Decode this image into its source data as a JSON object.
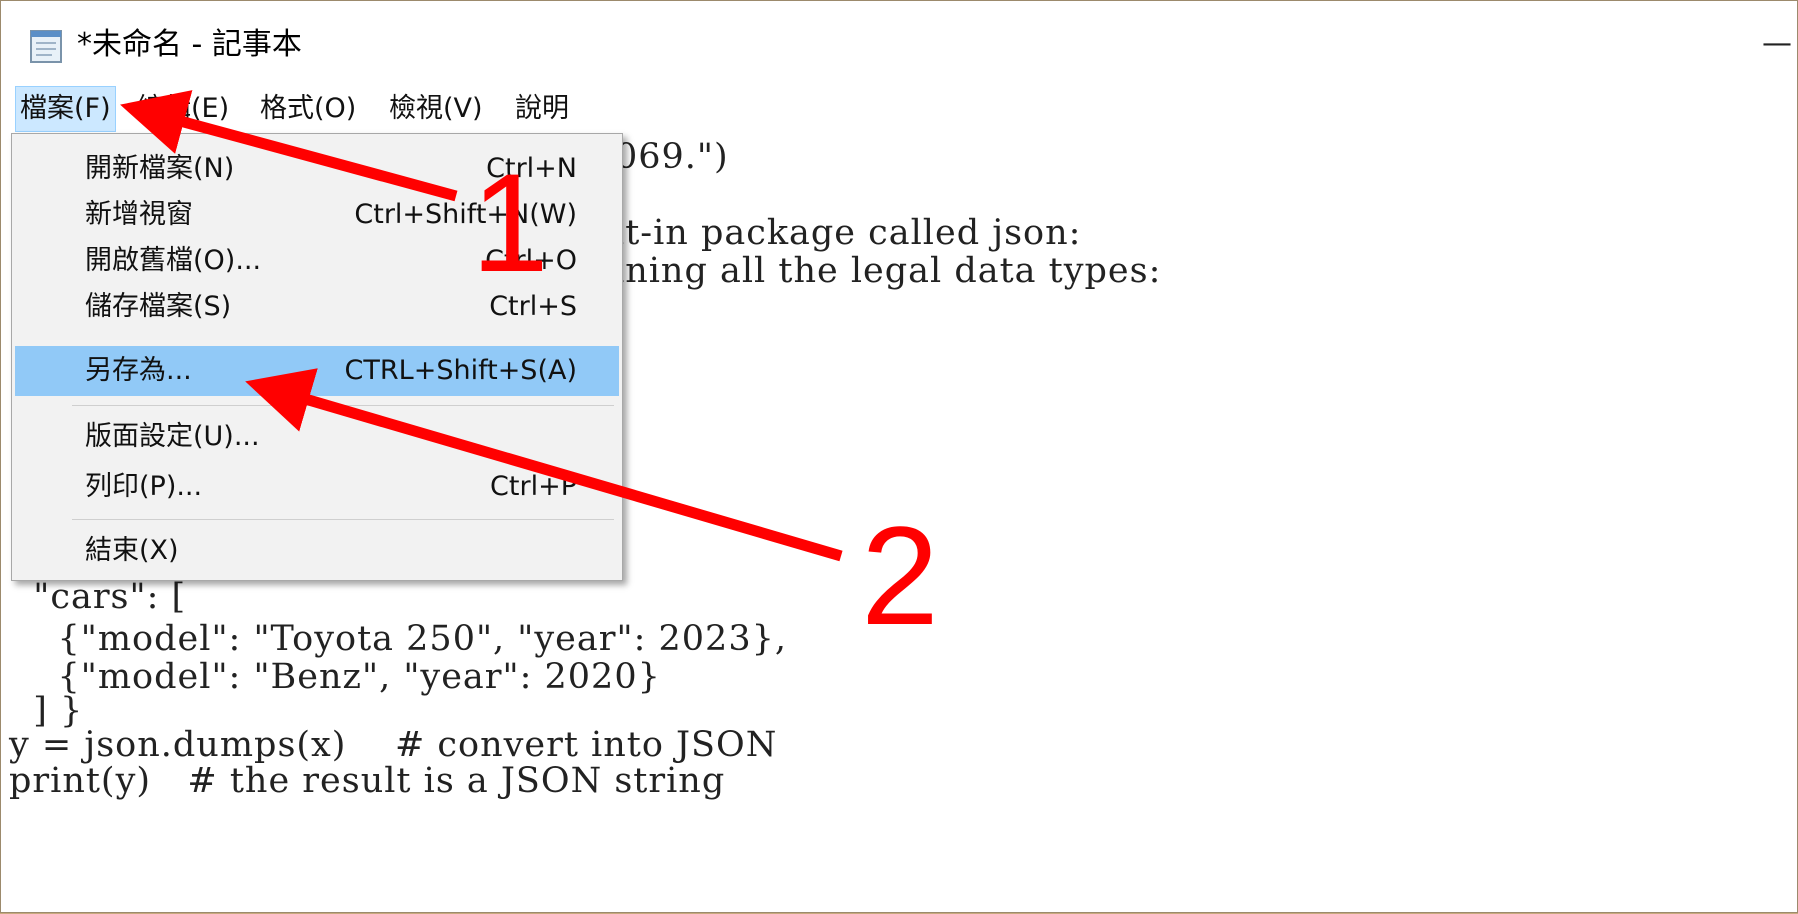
{
  "window": {
    "title": "*未命名 - 記事本",
    "minimize_glyph": "—",
    "app_icon": "notepad-icon"
  },
  "menubar": {
    "items": [
      {
        "label": "檔案(F)"
      },
      {
        "label": "編輯(E)"
      },
      {
        "label": "格式(O)"
      },
      {
        "label": "檢視(V)"
      },
      {
        "label": "說明"
      }
    ]
  },
  "editor": {
    "lines": [
      "069.\")",
      "lt-in package called json:",
      "ining all the legal data types:",
      "  \"cars\": [",
      "    {\"model\": \"Toyota 250\", \"year\": 2023},",
      "    {\"model\": \"Benz\", \"year\": 2020}",
      "  ] }",
      "y = json.dumps(x)    # convert into JSON",
      "print(y)   # the result is a JSON string"
    ]
  },
  "file_menu": {
    "items": [
      {
        "label": "開新檔案(N)",
        "shortcut": "Ctrl+N"
      },
      {
        "label": "新增視窗",
        "shortcut": "Ctrl+Shift+N(W)"
      },
      {
        "label": "開啟舊檔(O)...",
        "shortcut": "Ctrl+O"
      },
      {
        "label": "儲存檔案(S)",
        "shortcut": "Ctrl+S"
      },
      {
        "label": "另存為...",
        "shortcut": "CTRL+Shift+S(A)",
        "highlighted": true
      },
      {
        "label": "版面設定(U)...",
        "shortcut": ""
      },
      {
        "label": "列印(P)...",
        "shortcut": "Ctrl+P"
      },
      {
        "label": "結束(X)",
        "shortcut": ""
      }
    ]
  },
  "annotations": {
    "step1": "1",
    "step2": "2",
    "color": "#ff0000"
  },
  "colors": {
    "menu_highlight": "#91c9f7",
    "menubar_active": "#cce8ff",
    "annotation": "#ff0000"
  }
}
